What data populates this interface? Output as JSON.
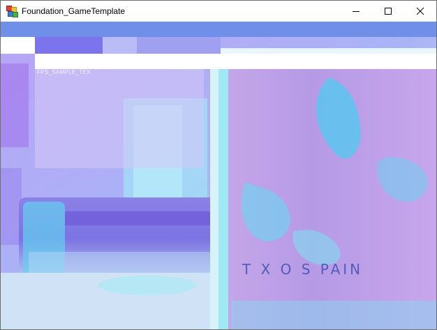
{
  "window": {
    "title": "Foundation_GameTemplate",
    "icon": "app-icon",
    "caption_buttons": [
      {
        "name": "minimize-icon"
      },
      {
        "name": "maximize-icon"
      },
      {
        "name": "close-icon"
      }
    ]
  },
  "scene": {
    "caption": "FPS_SAMPLE_TEX",
    "canvas_text": "T X O S PAIN"
  },
  "colors": {
    "menustrip": "#6f8fe8",
    "toolstrip_button_1": "#7c74ec",
    "toolstrip_button_2": "#b9bcf6",
    "statusbar": "#ffffff"
  }
}
